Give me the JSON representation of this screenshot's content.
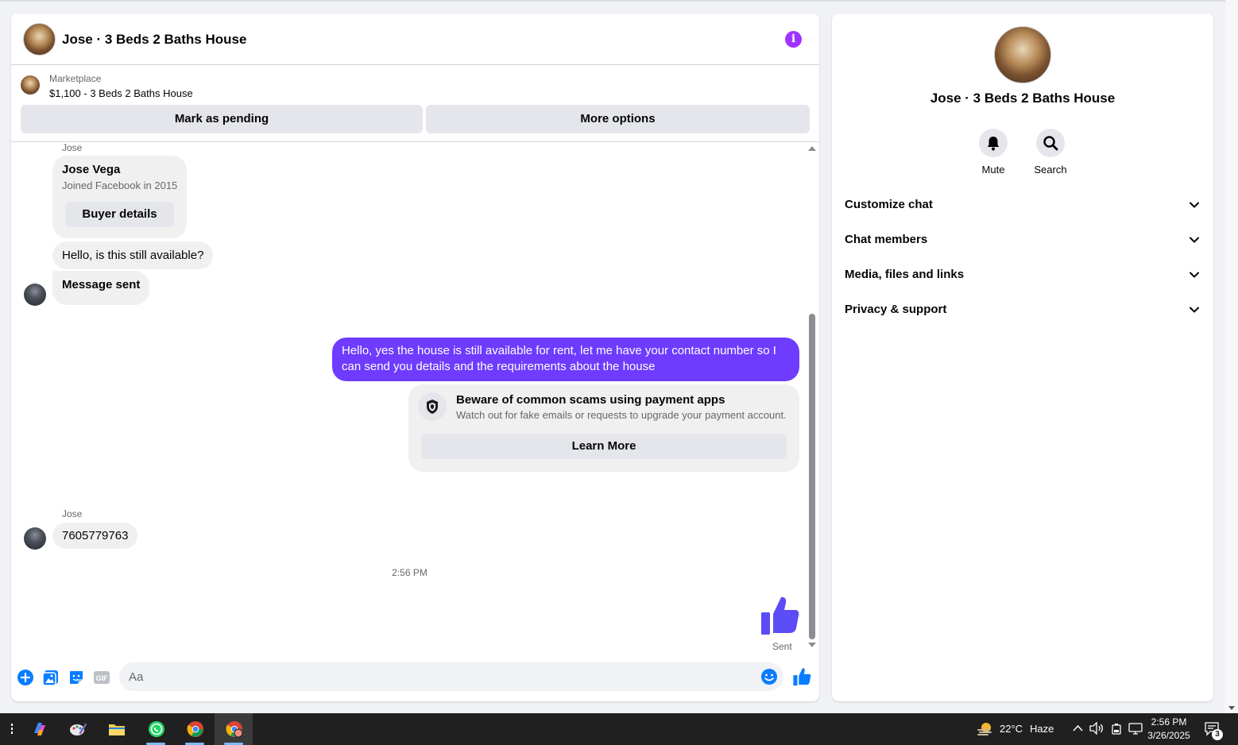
{
  "chat": {
    "title": "Jose · 3 Beds 2 Baths House",
    "marketplace": {
      "label": "Marketplace",
      "item": "$1,100 - 3 Beds 2 Baths House",
      "mark_pending": "Mark as pending",
      "more_options": "More options"
    },
    "messages": {
      "sender_top": "Jose",
      "buyer_name": "Jose Vega",
      "buyer_joined": "Joined Facebook in 2015",
      "buyer_details": "Buyer details",
      "msg1": "Hello, is this still available?",
      "msg2": "Message sent",
      "out1": "Hello, yes the house is still available for rent, let me have your contact number so I can send you details and the requirements about the house",
      "scam_title": "Beware of common scams using payment apps",
      "scam_desc": "Watch out for fake emails or requests to upgrade your payment account.",
      "learn_more": "Learn More",
      "sender_bottom": "Jose",
      "phone": "7605779763",
      "time": "2:56 PM",
      "sent": "Sent"
    },
    "composer": {
      "placeholder": "Aa"
    },
    "colors": {
      "accent": "#6e3bff",
      "info": "#a033ff",
      "icon_blue": "#0a7cff"
    }
  },
  "side": {
    "title": "Jose · 3 Beds 2 Baths House",
    "actions": [
      {
        "label": "Mute",
        "icon": "bell-icon"
      },
      {
        "label": "Search",
        "icon": "search-icon"
      }
    ],
    "rows": [
      {
        "label": "Customize chat"
      },
      {
        "label": "Chat members"
      },
      {
        "label": "Media, files and links"
      },
      {
        "label": "Privacy & support"
      }
    ]
  },
  "taskbar": {
    "weather_temp": "22°C",
    "weather_desc": "Haze",
    "time": "2:56 PM",
    "date": "3/26/2025",
    "notifications": "3",
    "apps": [
      "copilot-icon",
      "paint-icon",
      "file-explorer-icon",
      "whatsapp-icon",
      "chrome-icon",
      "chrome-profile-icon"
    ]
  }
}
